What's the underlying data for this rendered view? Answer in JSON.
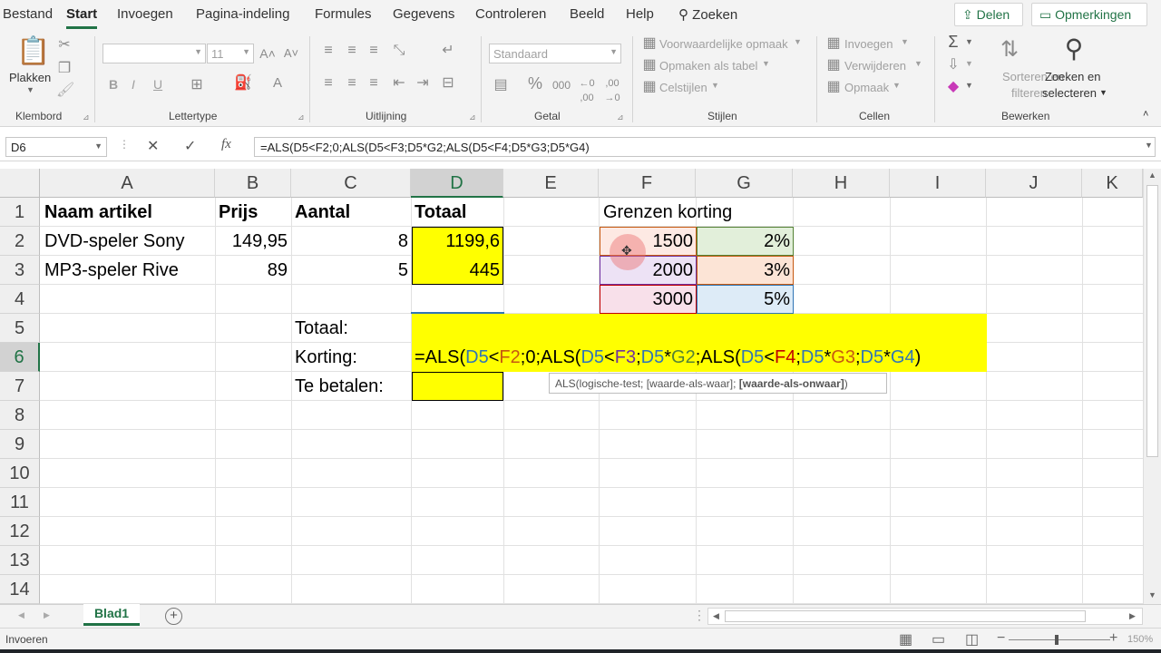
{
  "menu": {
    "tabs": [
      "Bestand",
      "Start",
      "Invoegen",
      "Pagina-indeling",
      "Formules",
      "Gegevens",
      "Controleren",
      "Beeld",
      "Help"
    ],
    "search": "Zoeken",
    "share": "Delen",
    "comments": "Opmerkingen"
  },
  "ribbon": {
    "clipboard": {
      "paste": "Plakken",
      "label": "Klembord"
    },
    "font": {
      "name": "",
      "size": "11",
      "bold": "B",
      "italic": "I",
      "underline": "U",
      "label": "Lettertype"
    },
    "alignment": {
      "label": "Uitlijning"
    },
    "number": {
      "format": "Standaard",
      "label": "Getal"
    },
    "styles": {
      "conditional": "Voorwaardelijke opmaak",
      "table": "Opmaken als tabel",
      "cell": "Celstijlen",
      "label": "Stijlen"
    },
    "cells": {
      "insert": "Invoegen",
      "delete": "Verwijderen",
      "format": "Opmaak",
      "label": "Cellen"
    },
    "editing": {
      "sort1": "Sorteren en",
      "sort2": "filteren",
      "find1": "Zoeken en",
      "find2": "selecteren",
      "label": "Bewerken"
    }
  },
  "formula_bar": {
    "name_box": "D6",
    "fx": "fx",
    "formula": "=ALS(D5<F2;0;ALS(D5<F3;D5*G2;ALS(D5<F4;D5*G3;D5*G4)"
  },
  "sheet": {
    "columns": [
      "A",
      "B",
      "C",
      "D",
      "E",
      "F",
      "G",
      "H",
      "I",
      "J",
      "K"
    ],
    "rows": [
      "1",
      "2",
      "3",
      "4",
      "5",
      "6",
      "7",
      "8",
      "9",
      "10",
      "11",
      "12",
      "13",
      "14"
    ],
    "cells": {
      "A1": "Naam artikel",
      "B1": "Prijs",
      "C1": "Aantal",
      "D1": "Totaal",
      "F1": "Grenzen korting",
      "A2": "DVD-speler Sony",
      "B2": "149,95",
      "C2": "8",
      "D2": "1199,6",
      "F2": "1500",
      "G2": "2%",
      "A3": "MP3-speler Rive",
      "B3": "89",
      "C3": "5",
      "D3": "445",
      "F3": "2000",
      "G3": "3%",
      "F4": "3000",
      "G4": "5%",
      "C5": "Totaal:",
      "C6": "Korting:",
      "C7": "Te betalen:"
    },
    "edit_formula_parts": [
      {
        "t": "=ALS(",
        "c": "#000000"
      },
      {
        "t": "D5",
        "c": "#2f75b5"
      },
      {
        "t": "<",
        "c": "#000000"
      },
      {
        "t": "F2",
        "c": "#c65911"
      },
      {
        "t": ";0;ALS(",
        "c": "#000000"
      },
      {
        "t": "D5",
        "c": "#2f75b5"
      },
      {
        "t": "<",
        "c": "#000000"
      },
      {
        "t": "F3",
        "c": "#7030a0"
      },
      {
        "t": ";",
        "c": "#000000"
      },
      {
        "t": "D5",
        "c": "#2f75b5"
      },
      {
        "t": "*",
        "c": "#000000"
      },
      {
        "t": "G2",
        "c": "#548235"
      },
      {
        "t": ";ALS(",
        "c": "#000000"
      },
      {
        "t": "D5",
        "c": "#2f75b5"
      },
      {
        "t": "<",
        "c": "#000000"
      },
      {
        "t": "F4",
        "c": "#c00000"
      },
      {
        "t": ";",
        "c": "#000000"
      },
      {
        "t": "D5",
        "c": "#2f75b5"
      },
      {
        "t": "*",
        "c": "#000000"
      },
      {
        "t": "G3",
        "c": "#c65911"
      },
      {
        "t": ";",
        "c": "#000000"
      },
      {
        "t": "D5",
        "c": "#2f75b5"
      },
      {
        "t": "*",
        "c": "#000000"
      },
      {
        "t": "G4",
        "c": "#2f75b5"
      },
      {
        "t": ")",
        "c": "#000000"
      }
    ],
    "tooltip": {
      "func": "ALS(logische-test; [waarde-als-waar]; ",
      "bold": "[waarde-als-onwaar]",
      "end": ")"
    }
  },
  "sheet_tabs": {
    "active": "Blad1"
  },
  "status": {
    "mode": "Invoeren",
    "zoom": "150%"
  }
}
